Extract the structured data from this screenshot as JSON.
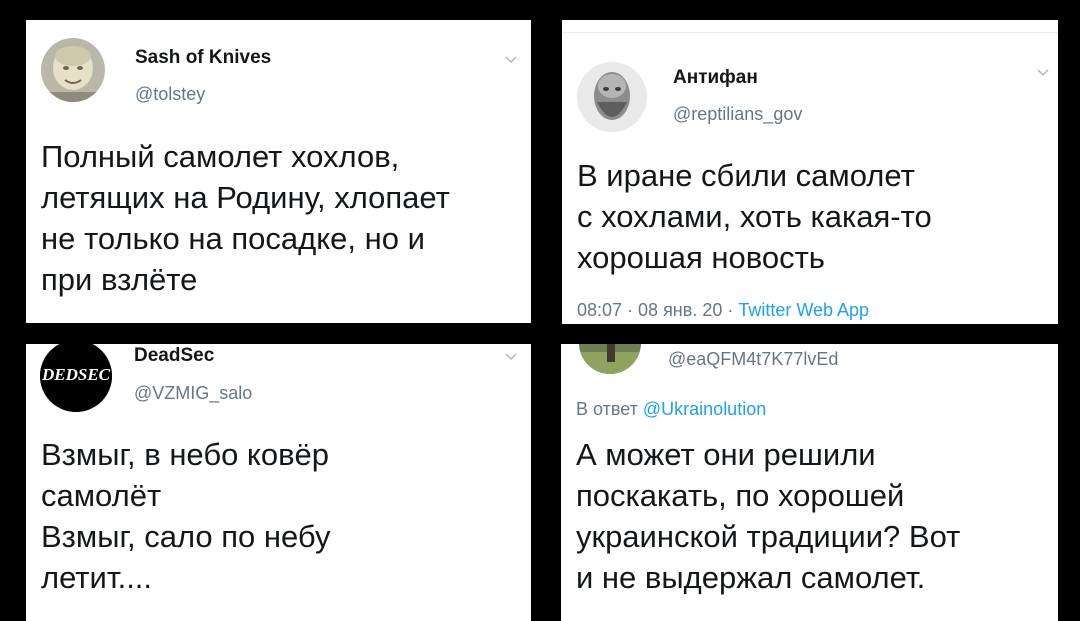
{
  "tweets": [
    {
      "name": "Sash of Knives",
      "handle": "@tolstey",
      "lines": [
        "Полный самолет хохлов,",
        "летящих на Родину, хлопает",
        "не только на посадке, но и",
        "при взлёте"
      ]
    },
    {
      "name": "Антифан",
      "handle": "@reptilians_gov",
      "lines": [
        "В иране сбили самолет",
        "с хохлами, хоть какая-то",
        "хорошая новость"
      ],
      "meta_time": "08:07 · 08 янв. 20 · ",
      "meta_source": "Twitter Web App"
    },
    {
      "name": "DeadSec",
      "handle": "@VZMIG_salo",
      "avatar_text": "DEDSEC",
      "lines": [
        "Взмыг, в небо ковёр",
        "самолёт",
        "Взмыг, сало по небу",
        "летит...."
      ]
    },
    {
      "handle": "@eaQFM4t7K77lvEd",
      "reply_prefix": "В ответ ",
      "reply_to": "@Ukrainolution",
      "lines": [
        "А может они решили",
        "поскакать, по хорошей",
        "украинской традиции? Вот",
        "и не выдержал самолет."
      ]
    }
  ],
  "colors": {
    "link": "#1da1f2",
    "secondary": "#657786",
    "text": "#14171a",
    "background": "#000000"
  },
  "icons": [
    "chevron-down-icon",
    "avatar"
  ]
}
